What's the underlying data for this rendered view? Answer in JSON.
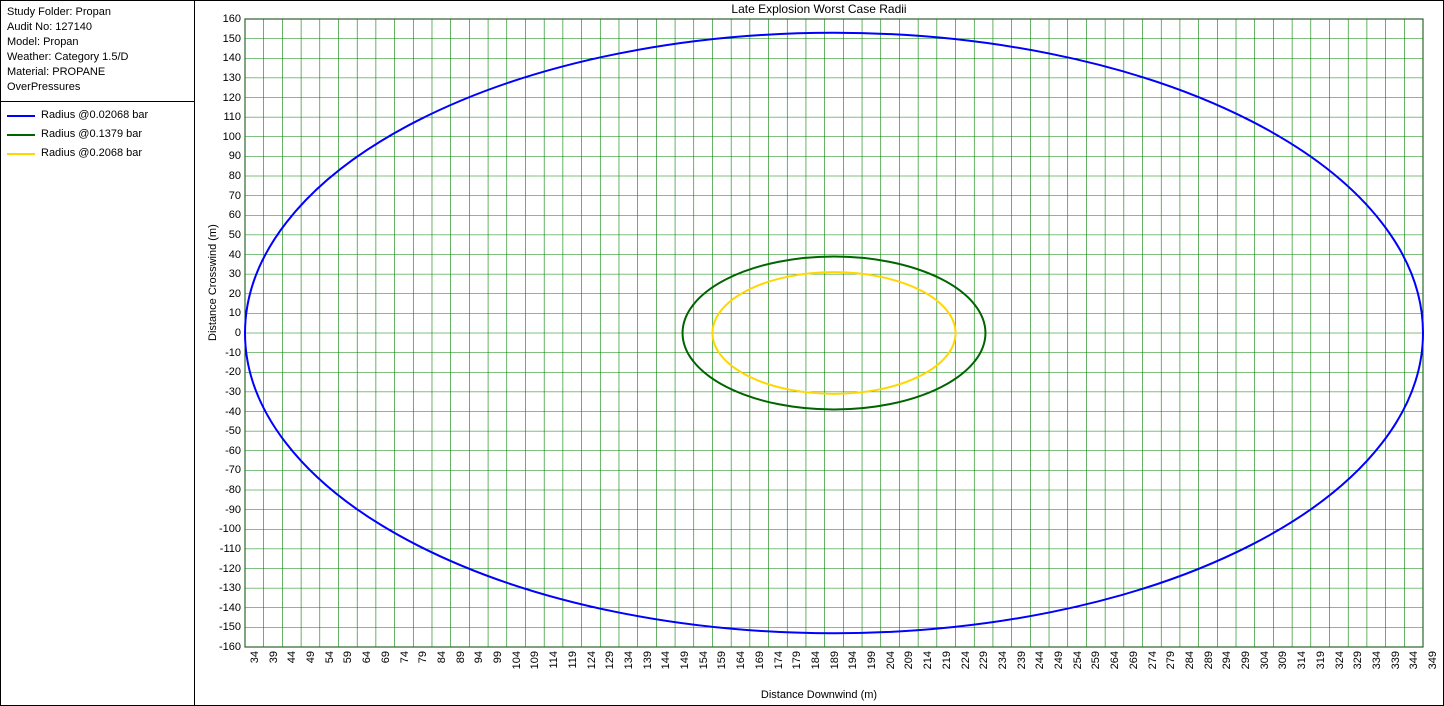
{
  "meta": {
    "study_folder": "Study Folder: Propan",
    "audit_no": "Audit No: 127140",
    "model": "Model: Propan",
    "weather": "Weather: Category 1.5/D",
    "material": "Material: PROPANE",
    "overpressures": "OverPressures"
  },
  "legend": {
    "items": [
      {
        "label": "Radius @0.02068 bar",
        "color": "#0000ff"
      },
      {
        "label": "Radius @0.1379 bar",
        "color": "#006400"
      },
      {
        "label": "Radius @0.2068 bar",
        "color": "#ffd700"
      }
    ]
  },
  "chart_data": {
    "type": "scatter",
    "title": "Late Explosion Worst Case Radii",
    "xlabel": "Distance Downwind (m)",
    "ylabel": "Distance Crosswind (m)",
    "xlim": [
      34,
      349
    ],
    "ylim": [
      -160,
      160
    ],
    "x_tick_step": 5,
    "y_tick_step": 10,
    "grid": true,
    "series": [
      {
        "name": "Radius @0.02068 bar",
        "color": "#0000ff",
        "shape": "ellipse",
        "cx": 191.5,
        "cy": 0,
        "rx": 157.5,
        "ry": 153
      },
      {
        "name": "Radius @0.1379 bar",
        "color": "#006400",
        "shape": "ellipse",
        "cx": 191.5,
        "cy": 0,
        "rx": 40.5,
        "ry": 39
      },
      {
        "name": "Radius @0.2068 bar",
        "color": "#ffd700",
        "shape": "ellipse",
        "cx": 191.5,
        "cy": 0,
        "rx": 32.5,
        "ry": 31
      }
    ]
  }
}
